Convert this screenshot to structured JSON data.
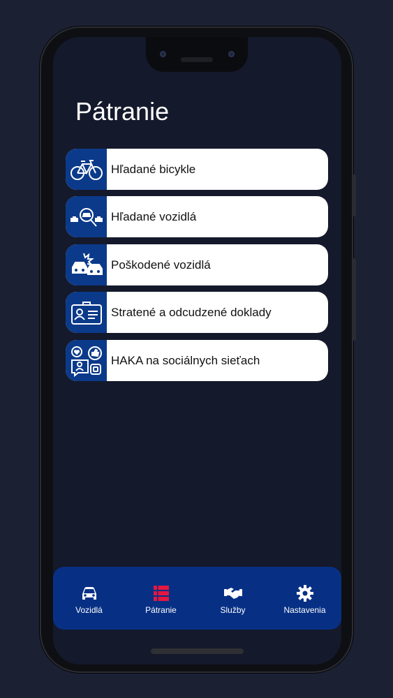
{
  "header": {
    "title": "Pátranie"
  },
  "menu": {
    "items": [
      {
        "label": "Hľadané bicykle",
        "icon": "bicycle-icon"
      },
      {
        "label": "Hľadané vozidlá",
        "icon": "car-search-icon"
      },
      {
        "label": "Poškodené vozidlá",
        "icon": "car-crash-icon"
      },
      {
        "label": "Stratené a odcudzené doklady",
        "icon": "id-card-icon"
      },
      {
        "label": "HAKA na sociálnych sieťach",
        "icon": "social-media-icon"
      }
    ]
  },
  "tabbar": {
    "tabs": [
      {
        "label": "Vozidlá",
        "icon": "car-icon",
        "active": false
      },
      {
        "label": "Pátranie",
        "icon": "list-icon",
        "active": true
      },
      {
        "label": "Služby",
        "icon": "handshake-icon",
        "active": false
      },
      {
        "label": "Nastavenia",
        "icon": "gear-icon",
        "active": false
      }
    ]
  },
  "colors": {
    "background": "#1b2033",
    "screen": "#14192b",
    "accent_blue": "#0b3a8a",
    "tabbar": "#073085",
    "active_icon": "#e5173f"
  }
}
